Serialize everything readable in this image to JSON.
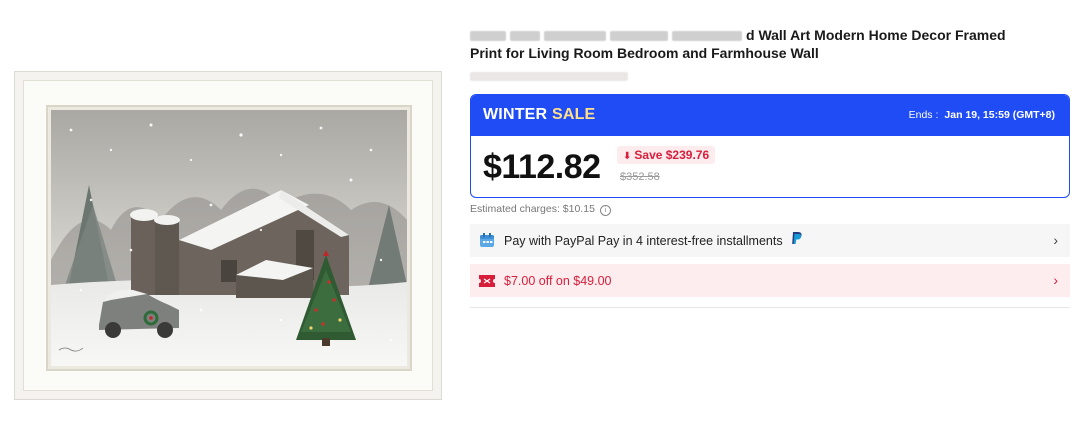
{
  "product": {
    "title_visible": "d Wall Art Modern Home Decor Framed",
    "title_line2": "Print for Living Room Bedroom and Farmhouse Wall"
  },
  "sale": {
    "title_part1": "WINTER ",
    "title_part2": "SALE",
    "ends_label": "Ends :",
    "ends_value": "Jan 19, 15:59 (GMT+8)",
    "price": "$112.82",
    "save": "Save $239.76",
    "original_price": "$352.58"
  },
  "estimated_charges": "Estimated charges: $10.15",
  "paypal_row": {
    "text": "Pay with PayPal Pay in 4 interest-free installments",
    "icon": "calendar-icon"
  },
  "coupon_row": {
    "text": "$7.00 off on $49.00",
    "icon": "coupon-icon"
  },
  "colors": {
    "brand_blue": "#1f4cf5",
    "sale_red": "#d81e3b",
    "sale_accent": "#ffe08a"
  }
}
